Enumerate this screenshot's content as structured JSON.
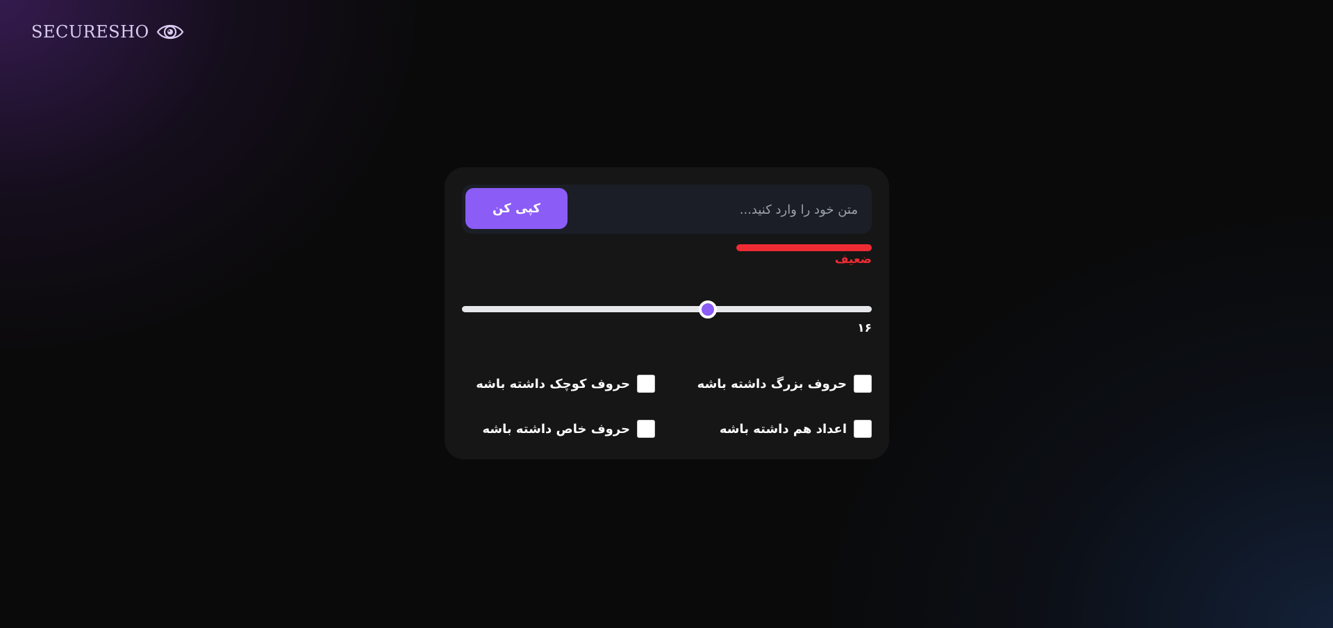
{
  "logo": {
    "text": "SECURESHO",
    "icon": "eye-icon",
    "color": "#d9ccf2"
  },
  "password_input": {
    "placeholder": "متن خود را وارد کنید...",
    "value": ""
  },
  "copy_button": {
    "label": "کپی کن",
    "color": "#8b5cf6"
  },
  "strength": {
    "label": "ضعیف",
    "level": 0.33,
    "color": "#ef2b34"
  },
  "length_slider": {
    "value_label": "۱۶",
    "value": 16,
    "min": 4,
    "max": 24
  },
  "options": {
    "uppercase": {
      "label": "حروف بزرگ داشته باشه",
      "checked": false
    },
    "lowercase": {
      "label": "حروف کوچک داشته باشه",
      "checked": false
    },
    "numbers": {
      "label": "اعداد هم داشته باشه",
      "checked": false
    },
    "special": {
      "label": "حروف خاص داشته باشه",
      "checked": false
    }
  },
  "colors": {
    "accent": "#8b5cf6",
    "card_bg": "#161616",
    "input_bg": "#1b1e26",
    "weak": "#ef2b34"
  }
}
